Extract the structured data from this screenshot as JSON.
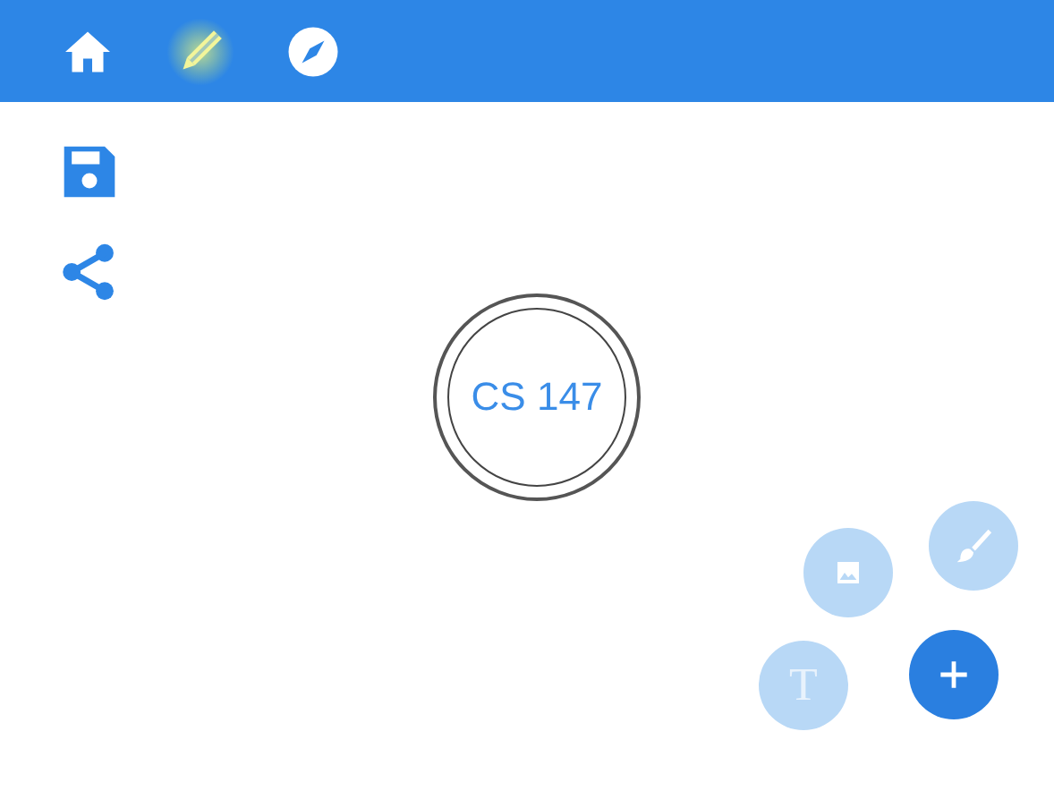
{
  "nav": [
    {
      "kind": "home",
      "selected": false
    },
    {
      "kind": "pencil",
      "selected": true
    },
    {
      "kind": "compass",
      "selected": false
    }
  ],
  "side_tools": [
    {
      "kind": "save"
    },
    {
      "kind": "share"
    }
  ],
  "badge": {
    "label": "CS 147"
  },
  "fab": [
    {
      "kind": "image"
    },
    {
      "kind": "brush"
    },
    {
      "kind": "text",
      "label": "T"
    },
    {
      "kind": "add"
    }
  ]
}
